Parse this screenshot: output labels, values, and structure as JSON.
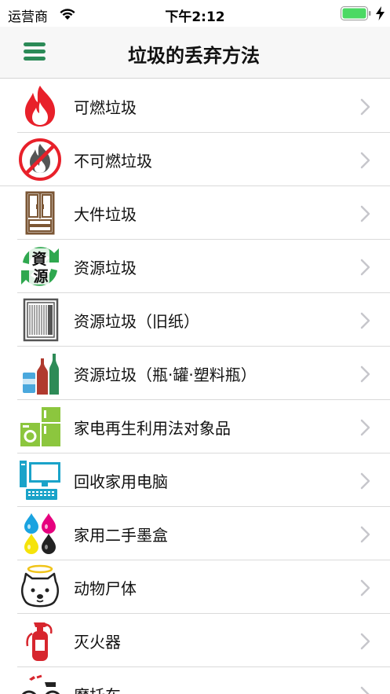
{
  "status_bar": {
    "carrier": "运营商",
    "time": "下午2:12",
    "battery_color": "#4cd964"
  },
  "nav": {
    "title": "垃圾的丢弃方法",
    "menu_icon": "hamburger-icon",
    "accent": "#2b8a57"
  },
  "items": [
    {
      "label": "可燃垃圾",
      "icon": "flame-icon"
    },
    {
      "label": "不可燃垃圾",
      "icon": "no-fire-icon"
    },
    {
      "label": "大件垃圾",
      "icon": "cabinet-icon"
    },
    {
      "label": "资源垃圾",
      "icon": "recycle-resource-icon",
      "icon_text_1": "資",
      "icon_text_2": "源"
    },
    {
      "label": "资源垃圾（旧纸）",
      "icon": "newspaper-icon"
    },
    {
      "label": "资源垃圾（瓶·罐·塑料瓶）",
      "icon": "bottles-icon"
    },
    {
      "label": "家电再生利用法对象品",
      "icon": "appliances-icon"
    },
    {
      "label": "回收家用电脑",
      "icon": "computer-icon"
    },
    {
      "label": "家用二手墨盒",
      "icon": "ink-drops-icon"
    },
    {
      "label": "动物尸体",
      "icon": "dog-angel-icon"
    },
    {
      "label": "灭火器",
      "icon": "fire-extinguisher-icon"
    },
    {
      "label": "摩托车",
      "icon": "motorcycle-icon"
    }
  ]
}
